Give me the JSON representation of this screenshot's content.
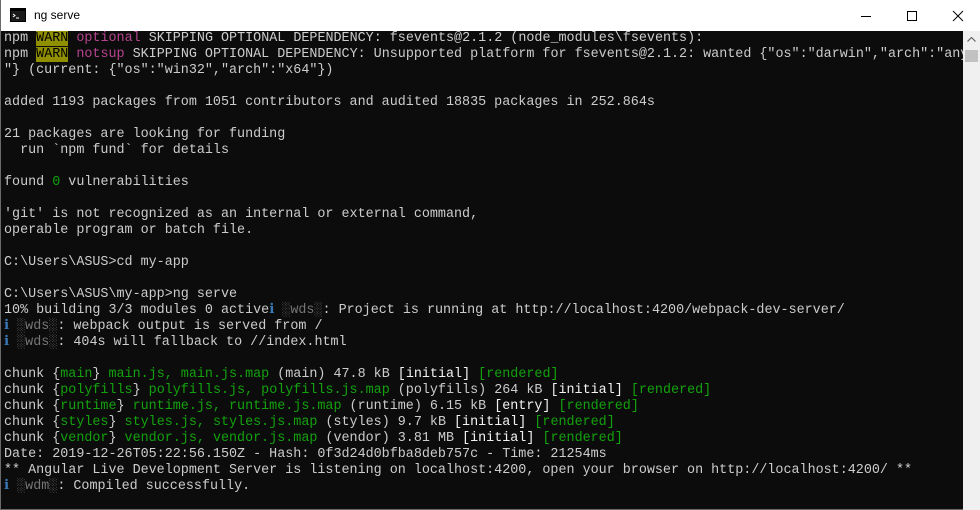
{
  "window": {
    "title": "ng serve",
    "icon": "cmd-icon",
    "controls": [
      "minimize-icon",
      "maximize-icon",
      "close-icon"
    ]
  },
  "terminal": {
    "l1": {
      "a": "npm ",
      "warn": "WARN",
      "b": " ",
      "tag": "optional",
      "c": " SKIPPING OPTIONAL DEPENDENCY: fsevents@2.1.2 (node_modules\\fsevents):"
    },
    "l2": {
      "a": "npm ",
      "warn": "WARN",
      "b": " ",
      "tag": "notsup",
      "c": " SKIPPING OPTIONAL DEPENDENCY: Unsupported platform for fsevents@2.1.2: wanted {\"os\":\"darwin\",\"arch\":\"any"
    },
    "l3": "\"} (current: {\"os\":\"win32\",\"arch\":\"x64\"})",
    "l5": "added 1193 packages from 1051 contributors and audited 18835 packages in 252.864s",
    "l7": "21 packages are looking for funding",
    "l8": "  run `npm fund` for details",
    "l10": {
      "a": "found ",
      "num": "0",
      "b": " vulnerabilities"
    },
    "l12": "'git' is not recognized as an internal or external command,",
    "l13": "operable program or batch file.",
    "l15": "C:\\Users\\ASUS>cd my-app",
    "l17": "C:\\Users\\ASUS\\my-app>ng serve",
    "l18": {
      "a": "10% building 3/3 modules 0 active",
      "info": "ℹ",
      "wds": " ░wds░",
      "b": ": Project is running at http://localhost:4200/webpack-dev-server/"
    },
    "l19": {
      "info": "ℹ",
      "wds": " ░wds░",
      "b": ": webpack output is served from /"
    },
    "l20": {
      "info": "ℹ",
      "wds": " ░wds░",
      "b": ": 404s will fallback to //index.html"
    },
    "chunks": [
      {
        "a": "chunk {",
        "name": "main",
        "b": "} ",
        "files": "main.js, main.js.map",
        "c": " (main) 47.8 kB ",
        "flag": "[initial]",
        "d": " ",
        "rendered": "[rendered]"
      },
      {
        "a": "chunk {",
        "name": "polyfills",
        "b": "} ",
        "files": "polyfills.js, polyfills.js.map",
        "c": " (polyfills) 264 kB ",
        "flag": "[initial]",
        "d": " ",
        "rendered": "[rendered]"
      },
      {
        "a": "chunk {",
        "name": "runtime",
        "b": "} ",
        "files": "runtime.js, runtime.js.map",
        "c": " (runtime) 6.15 kB ",
        "flag": "[entry]",
        "d": " ",
        "rendered": "[rendered]"
      },
      {
        "a": "chunk {",
        "name": "styles",
        "b": "} ",
        "files": "styles.js, styles.js.map",
        "c": " (styles) 9.7 kB ",
        "flag": "[initial]",
        "d": " ",
        "rendered": "[rendered]"
      },
      {
        "a": "chunk {",
        "name": "vendor",
        "b": "} ",
        "files": "vendor.js, vendor.js.map",
        "c": " (vendor) 3.81 MB ",
        "flag": "[initial]",
        "d": " ",
        "rendered": "[rendered]"
      }
    ],
    "l27": "Date: 2019-12-26T05:22:56.150Z - Hash: 0f3d24d0bfba8deb757c - Time: 21254ms",
    "l28": "** Angular Live Development Server is listening on localhost:4200, open your browser on http://localhost:4200/ **",
    "l29": {
      "info": "ℹ",
      "wdm": " ░wdm░",
      "b": ": Compiled successfully."
    }
  },
  "colors": {
    "background": "#0c0c0c",
    "text": "#cccccc",
    "warn_bg": "#8f8f00",
    "magenta": "#b5448e",
    "green": "#13a10e",
    "blue": "#3a96dd"
  }
}
